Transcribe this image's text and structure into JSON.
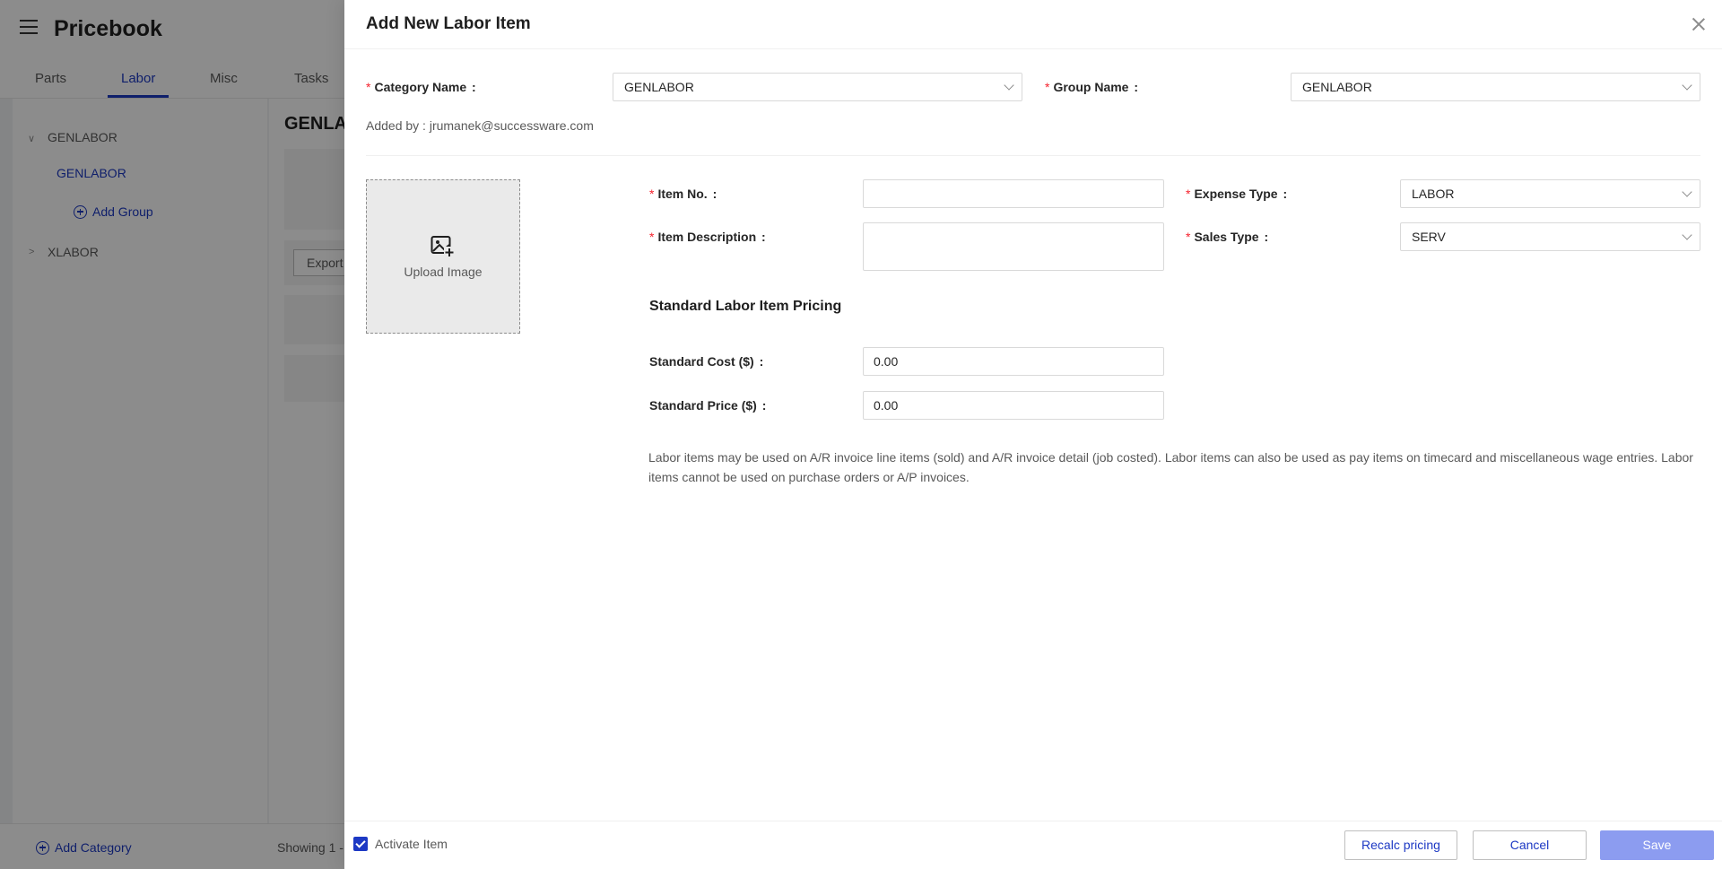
{
  "background": {
    "app_title": "Pricebook",
    "tabs": [
      {
        "label": "Parts"
      },
      {
        "label": "Labor"
      },
      {
        "label": "Misc"
      },
      {
        "label": "Tasks"
      }
    ],
    "tree": {
      "category1": "GENLABOR",
      "group1": "GENLABOR",
      "add_group": "Add Group",
      "category2": "XLABOR"
    },
    "main_title": "GENLA",
    "export_label": "Export",
    "add_category": "Add Category",
    "showing_text": "Showing 1 -"
  },
  "drawer": {
    "title": "Add New Labor Item",
    "category_name": {
      "label": "Category Name",
      "value": "GENLABOR"
    },
    "group_name": {
      "label": "Group Name",
      "value": "GENLABOR"
    },
    "added_by": "Added by : jrumanek@successware.com",
    "upload_image": "Upload Image",
    "item_no": {
      "label": "Item No.",
      "value": ""
    },
    "item_description": {
      "label": "Item Description",
      "value": ""
    },
    "expense_type": {
      "label": "Expense Type",
      "value": "LABOR"
    },
    "sales_type": {
      "label": "Sales Type",
      "value": "SERV"
    },
    "pricing_section_title": "Standard Labor Item Pricing",
    "standard_cost": {
      "label": "Standard Cost ($)",
      "value": "0.00"
    },
    "standard_price": {
      "label": "Standard Price ($)",
      "value": "0.00"
    },
    "note": "Labor items may be used on A/R invoice line items (sold) and A/R invoice detail (job costed). Labor items can also be used as pay items on timecard and miscellaneous wage entries. Labor items cannot be used on purchase orders or A/P invoices.",
    "activate_item": {
      "label": "Activate Item",
      "checked": true
    },
    "buttons": {
      "recalc": "Recalc pricing",
      "cancel": "Cancel",
      "save": "Save"
    }
  },
  "colors": {
    "accent": "#1d39c4",
    "required": "#f5222d",
    "save_disabled": "#8c9cf0"
  },
  "required_mark": "*",
  "colon": ":"
}
